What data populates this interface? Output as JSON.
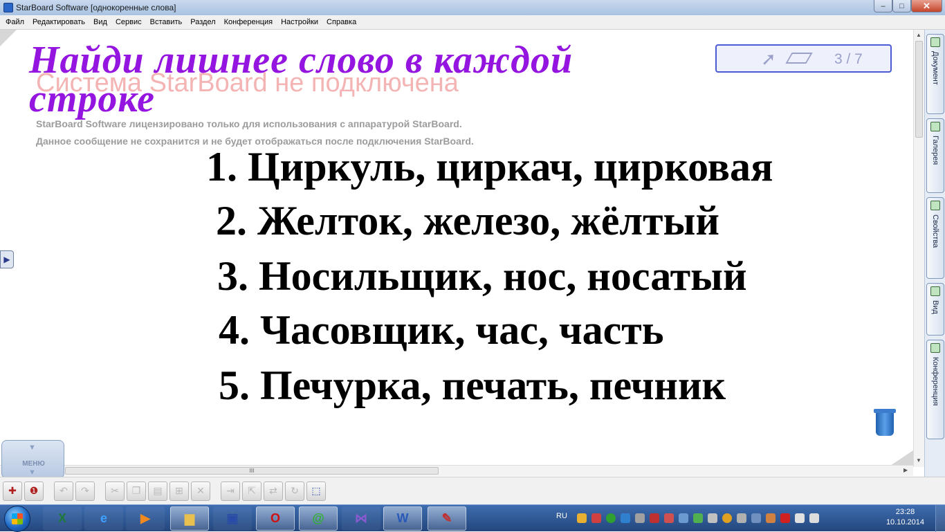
{
  "window": {
    "title": "StarBoard Software [однокоренные слова]",
    "minimize": "–",
    "maximize": "□",
    "close": "✕"
  },
  "menu": [
    "Файл",
    "Редактировать",
    "Вид",
    "Сервис",
    "Вставить",
    "Раздел",
    "Конференция",
    "Настройки",
    "Справка"
  ],
  "slide": {
    "heading": "Найди лишнее слово в каждой строке",
    "lines": [
      "1. Циркуль, циркач, цирковая",
      "2. Желток, железо, жёлтый",
      "3. Носильщик, нос, носатый",
      "4. Часовщик, час, часть",
      "5. Печурка, печать, печник"
    ]
  },
  "watermark": {
    "title": "Система StarBoard не подключена",
    "line1": "StarBoard Software лицензировано только для использования с аппаратурой StarBoard.",
    "line2": "Данное сообщение не сохранится и не будет отображаться после подключения StarBoard."
  },
  "page_indicator": {
    "text": "3 / 7",
    "current": 3,
    "total": 7
  },
  "side_tabs": [
    "Документ",
    "Галерея",
    "Свойства",
    "Вид",
    "Конференция"
  ],
  "menu_button": {
    "label": "МЕНЮ"
  },
  "scrollbar": {
    "grip": "III"
  },
  "toolbar_icons": [
    "new-page-icon",
    "copy-page-icon",
    "undo-icon",
    "redo-icon",
    "cut-icon",
    "copy-icon",
    "paste-icon",
    "duplicate-icon",
    "delete-icon",
    "move-front-icon",
    "move-back-icon",
    "flip-icon",
    "rotate-icon",
    "select-area-icon"
  ],
  "taskbar": {
    "apps": [
      "excel",
      "internet-explorer",
      "media-player",
      "file-explorer",
      "save",
      "opera",
      "mail-agent",
      "visual-studio",
      "word",
      "starboard"
    ],
    "lang": "RU",
    "time": "23:28",
    "date": "10.10.2014"
  }
}
